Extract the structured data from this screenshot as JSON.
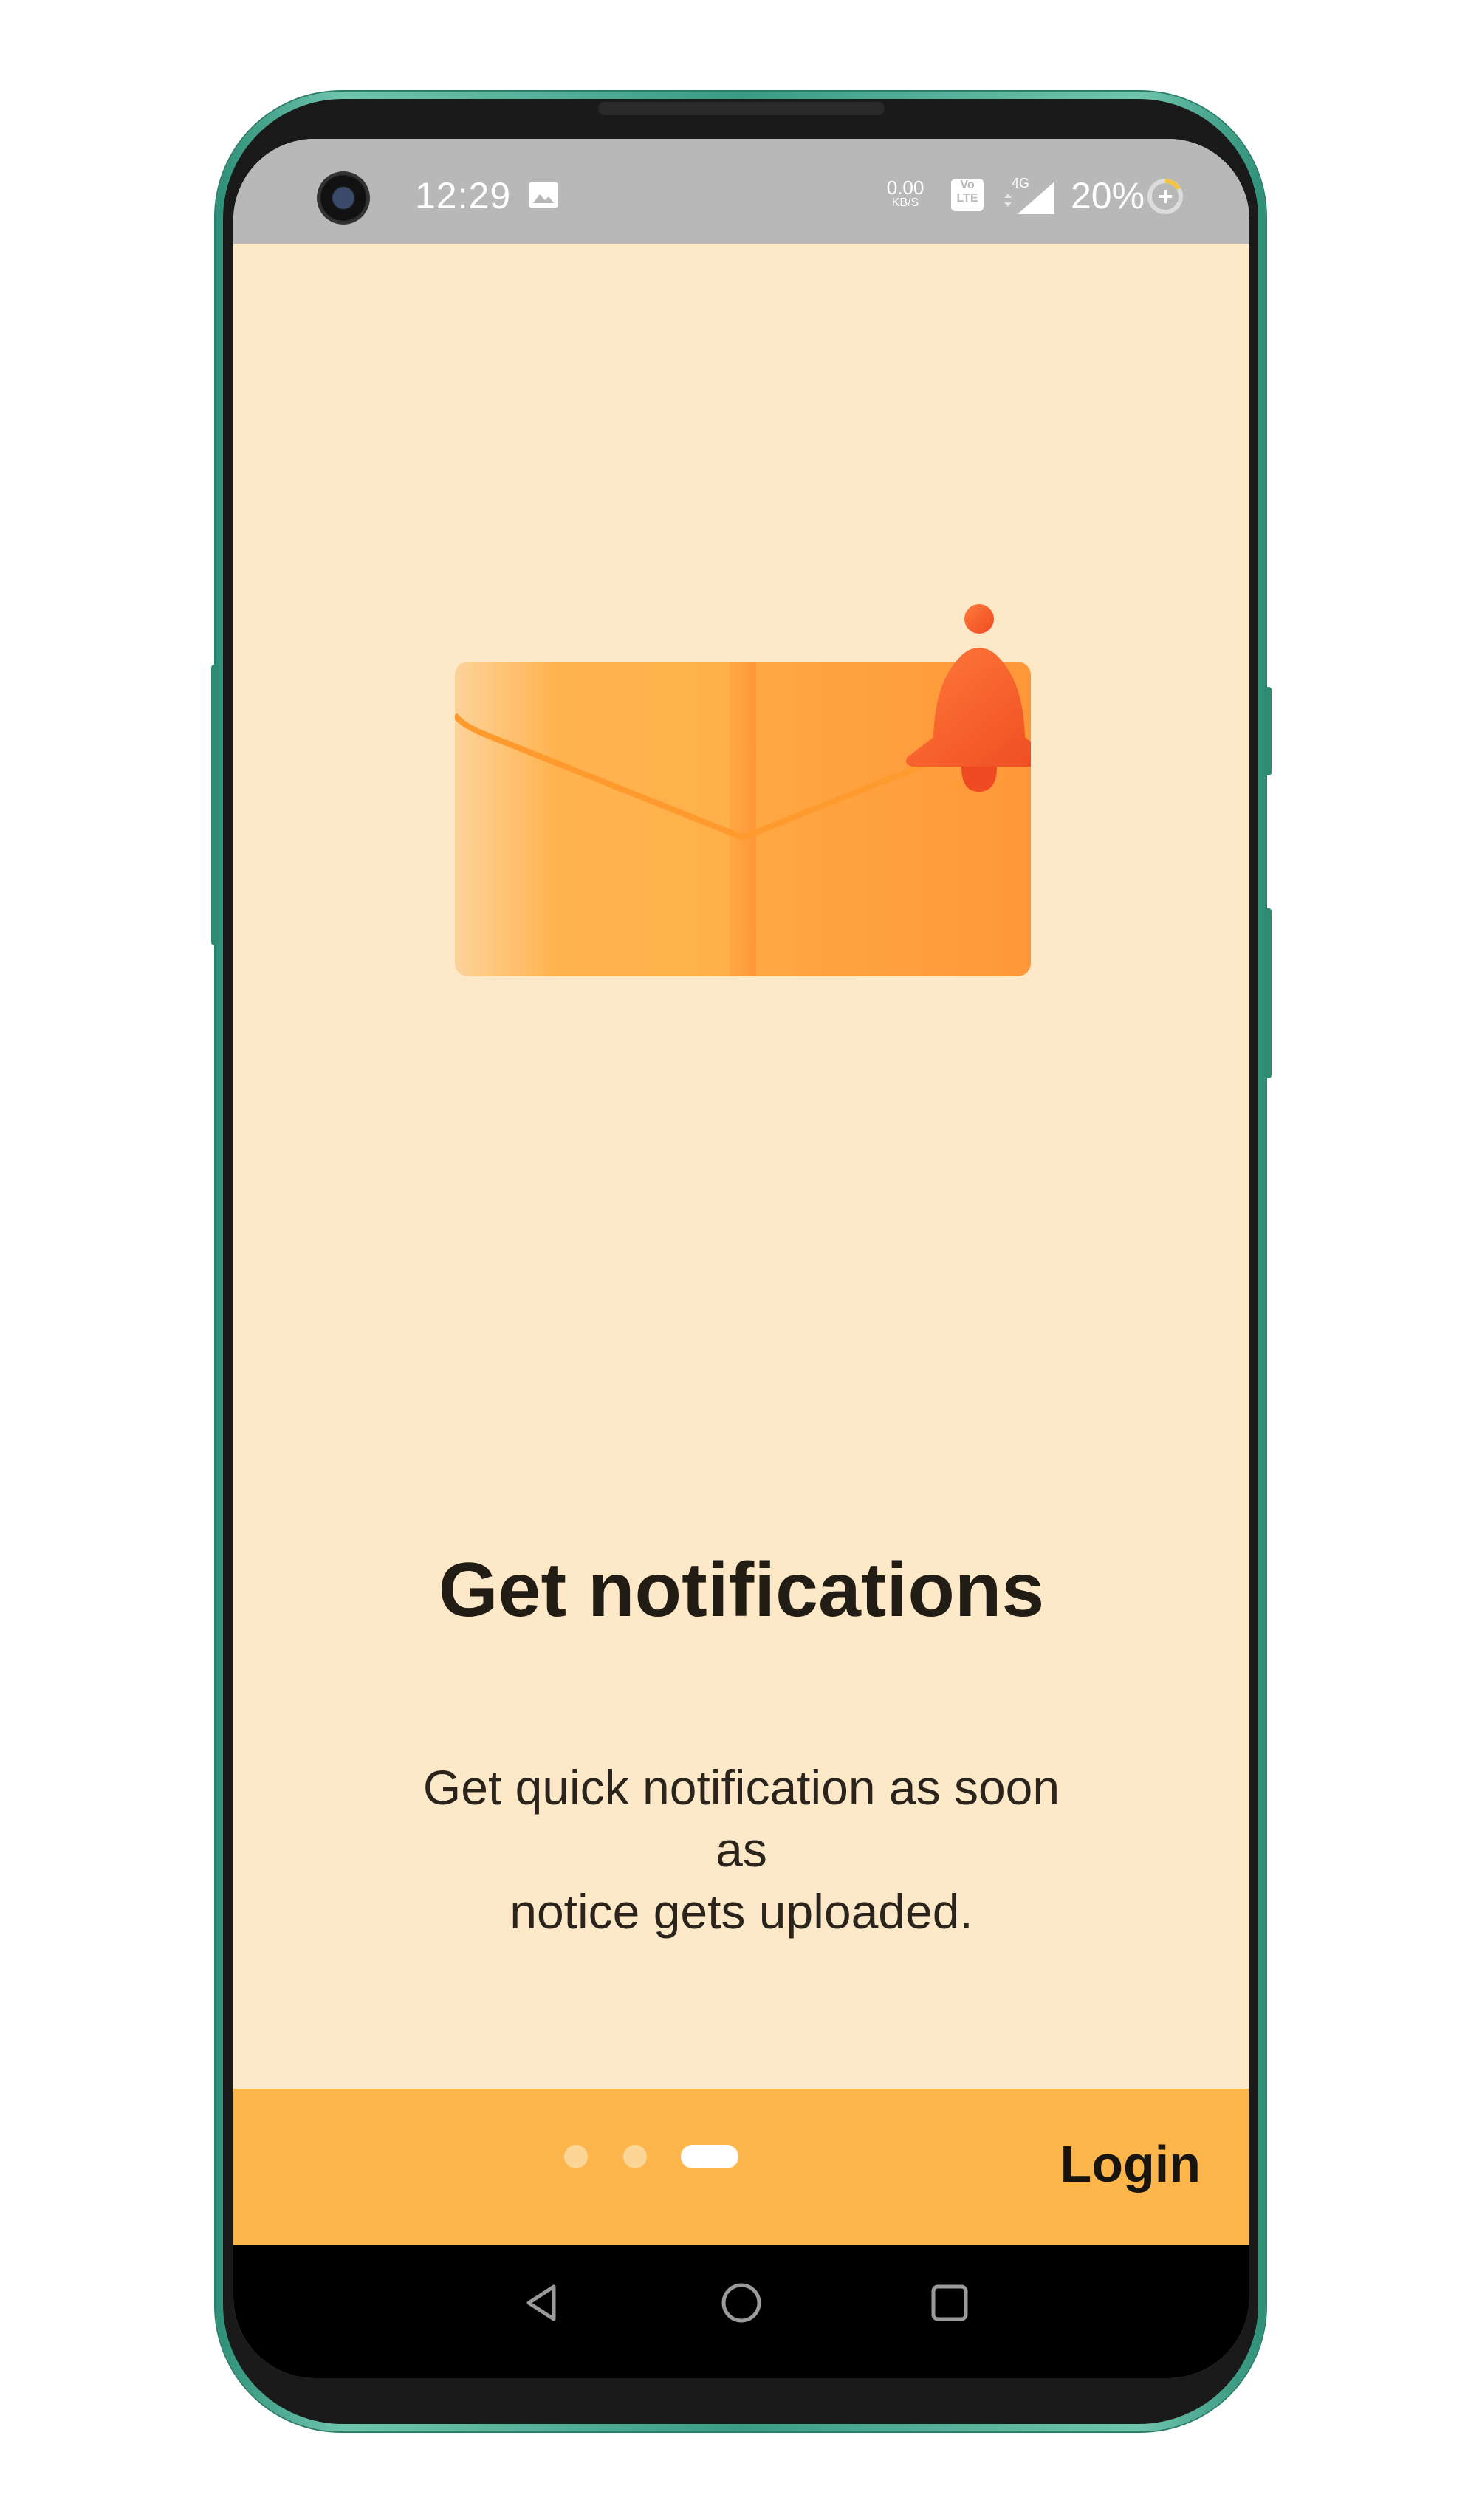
{
  "status_bar": {
    "time": "12:29",
    "net_speed_value": "0.00",
    "net_speed_unit": "KB/S",
    "volte_line1": "Vo",
    "volte_line2": "LTE",
    "network_type": "4G",
    "battery_percent": "20%",
    "icons": [
      "camera-icon",
      "image-icon",
      "volte-icon",
      "signal-icon",
      "battery-charging-icon"
    ]
  },
  "onboarding": {
    "illustration": "envelope-with-bell-icon",
    "title": "Get notifications",
    "description": "Get quick notification as soon as\nnotice  gets uploaded.",
    "page_indicator": {
      "total": 3,
      "current": 3
    },
    "login_label": "Login"
  },
  "nav_bar": {
    "icons": [
      "back-icon",
      "home-icon",
      "recent-apps-icon"
    ]
  },
  "colors": {
    "screen_background": "#fde8c7",
    "bottom_bar": "#fdb64c",
    "status_bar": "#b8b8b8",
    "bell": "#f2552a",
    "envelope": "#ffa840"
  }
}
